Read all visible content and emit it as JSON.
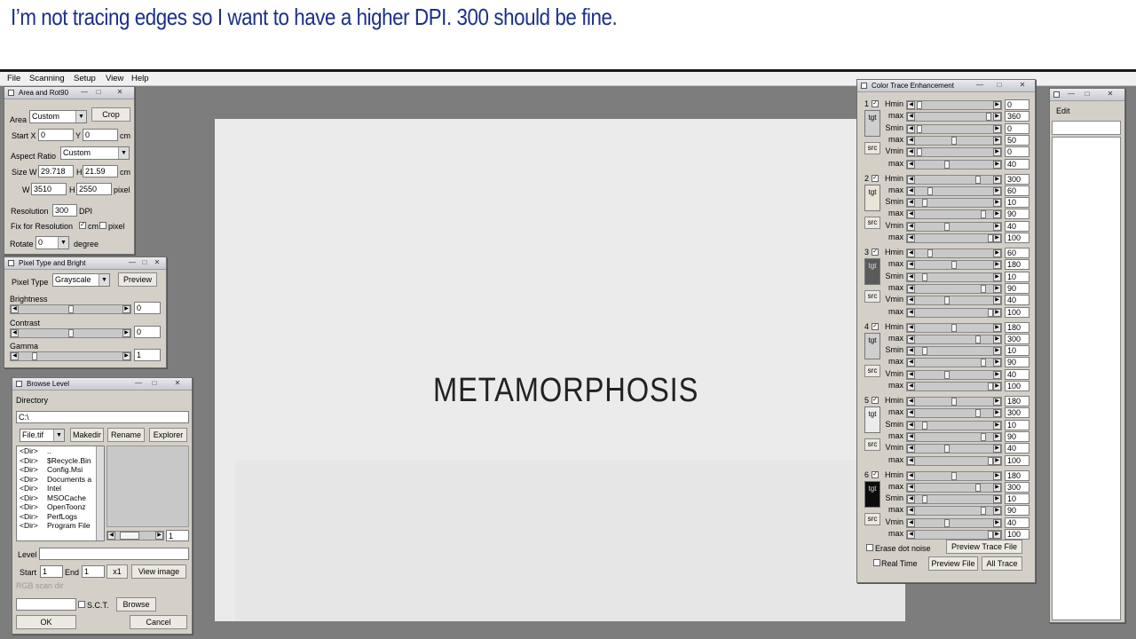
{
  "caption": "I’m not tracing edges so I want to have a higher DPI. 300 should be fine.",
  "menubar": [
    "File",
    "Scanning",
    "Setup",
    "View",
    "Help"
  ],
  "window_buttons": {
    "minimize": "—",
    "maximize": "□",
    "close": "✕"
  },
  "area_window": {
    "title": "Area and Rot90",
    "area_label": "Area",
    "area_value": "Custom",
    "crop_label": "Crop",
    "startx_label": "Start X",
    "startx_value": "0",
    "y_label": "Y",
    "y_value": "0",
    "unit_cm": "cm",
    "aspect_label": "Aspect Ratio",
    "aspect_value": "Custom",
    "size_label": "Size",
    "w_label": "W",
    "w_value": "29.718",
    "h_label": "H",
    "h_value": "21.59",
    "pw_value": "3510",
    "ph_value": "2550",
    "unit_pixel": "pixel",
    "resolution_label": "Resolution",
    "resolution_value": "300",
    "dpi_label": "DPI",
    "fix_label": "Fix for Resolution",
    "fix_cm": "cm",
    "fix_pixel": "pixel",
    "rotate_label": "Rotate",
    "rotate_value": "0",
    "degree_label": "degree"
  },
  "pixel_window": {
    "title": "Pixel Type and Bright",
    "pixel_type_label": "Pixel Type",
    "pixel_type_value": "Grayscale",
    "preview_label": "Preview",
    "brightness_label": "Brightness",
    "brightness_value": "0",
    "contrast_label": "Contrast",
    "contrast_value": "0",
    "gamma_label": "Gamma",
    "gamma_value": "1"
  },
  "browse_window": {
    "title": "Browse Level",
    "directory_label": "Directory",
    "directory_value": "C:\\",
    "filter_value": "File.tif",
    "makedir_label": "Makedir",
    "rename_label": "Rename",
    "explorer_label": "Explorer",
    "entries": [
      {
        "tag": "<Dir>",
        "name": ".."
      },
      {
        "tag": "<Dir>",
        "name": "$Recycle.Bin"
      },
      {
        "tag": "<Dir>",
        "name": "Config.Msi"
      },
      {
        "tag": "<Dir>",
        "name": "Documents a"
      },
      {
        "tag": "<Dir>",
        "name": "Intel"
      },
      {
        "tag": "<Dir>",
        "name": "MSOCache"
      },
      {
        "tag": "<Dir>",
        "name": "OpenToonz"
      },
      {
        "tag": "<Dir>",
        "name": "PerfLogs"
      },
      {
        "tag": "<Dir>",
        "name": "Program File"
      }
    ],
    "page_value": "1",
    "level_label": "Level",
    "start_label": "Start",
    "start_value": "1",
    "end_label": "End",
    "end_value": "1",
    "x1_label": "x1",
    "view_image_label": "View image",
    "rgb_label": "RGB scan dir",
    "sct_label": "S.C.T.",
    "browse_label": "Browse",
    "ok_label": "OK",
    "cancel_label": "Cancel"
  },
  "canvas": {
    "text": "METAMORPHOSIS"
  },
  "color_trace": {
    "title": "Color Trace Enhancement",
    "tgt_label": "tgt",
    "src_label": "src",
    "labels": [
      "Hmin",
      "max",
      "Smin",
      "max",
      "Vmin",
      "max"
    ],
    "groups": [
      {
        "num": "1",
        "swatch": "#cfcfcf",
        "values": [
          "0",
          "360",
          "0",
          "50",
          "0",
          "40"
        ],
        "levels": [
          0.02,
          0.98,
          0.02,
          0.5,
          0.02,
          0.4
        ]
      },
      {
        "num": "2",
        "swatch": "#e9e4d8",
        "values": [
          "300",
          "60",
          "10",
          "90",
          "40",
          "100"
        ],
        "levels": [
          0.83,
          0.17,
          0.1,
          0.9,
          0.4,
          1.0
        ]
      },
      {
        "num": "3",
        "swatch": "#5a5a5a",
        "values": [
          "60",
          "180",
          "10",
          "90",
          "40",
          "100"
        ],
        "levels": [
          0.17,
          0.5,
          0.1,
          0.9,
          0.4,
          1.0
        ]
      },
      {
        "num": "4",
        "swatch": "#cfcfcf",
        "values": [
          "180",
          "300",
          "10",
          "90",
          "40",
          "100"
        ],
        "levels": [
          0.5,
          0.83,
          0.1,
          0.9,
          0.4,
          1.0
        ]
      },
      {
        "num": "5",
        "swatch": "#ececec",
        "values": [
          "180",
          "300",
          "10",
          "90",
          "40",
          "100"
        ],
        "levels": [
          0.5,
          0.83,
          0.1,
          0.9,
          0.4,
          1.0
        ]
      },
      {
        "num": "6",
        "swatch": "#0c0c0c",
        "values": [
          "180",
          "300",
          "10",
          "90",
          "40",
          "100"
        ],
        "levels": [
          0.5,
          0.83,
          0.1,
          0.9,
          0.4,
          1.0
        ]
      }
    ],
    "erase_label": "Erase dot noise",
    "preview_trace_label": "Preview Trace File",
    "realtime_label": "Real Time",
    "preview_file_label": "Preview File",
    "all_trace_label": "All Trace"
  },
  "edit_window": {
    "edit_label": "Edit"
  }
}
